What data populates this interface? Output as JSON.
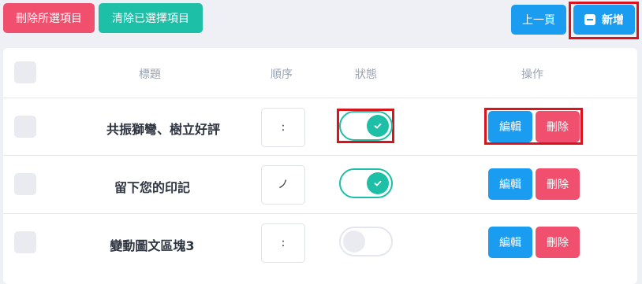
{
  "toolbar": {
    "delete_selected": "刪除所選項目",
    "clear_selected": "清除已選擇項目",
    "prev_page": "上一頁",
    "add_new": "新增"
  },
  "table": {
    "headers": {
      "title": "標題",
      "order": "順序",
      "status": "狀態",
      "actions": "操作"
    },
    "rows": [
      {
        "title": "共振獅彎、樹立好評",
        "order": ":",
        "status_on": true,
        "edit": "編輯",
        "delete": "刪除"
      },
      {
        "title": "留下您的印記",
        "order": "ノ",
        "status_on": true,
        "edit": "編輯",
        "delete": "刪除"
      },
      {
        "title": "變動圖文區塊3",
        "order": ":",
        "status_on": false,
        "edit": "編輯",
        "delete": "刪除"
      }
    ]
  },
  "colors": {
    "red": "#f0506e",
    "teal": "#1dc0a6",
    "blue": "#1a9cf0",
    "highlight": "#d9141c"
  }
}
